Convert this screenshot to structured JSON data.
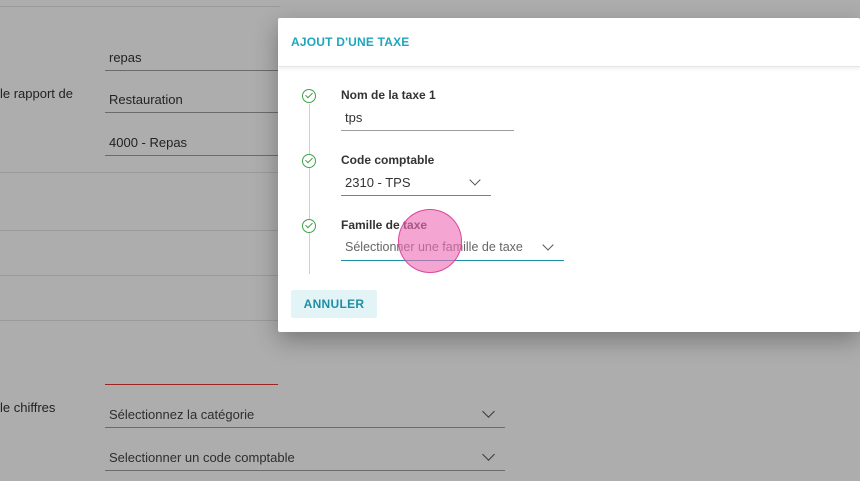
{
  "background_form": {
    "field_values": [
      "repas",
      "Restauration",
      "4000 - Repas"
    ],
    "partial_labels": [
      "le rapport de",
      "le chiffres"
    ],
    "category_placeholder": "Sélectionnez la catégorie",
    "account_placeholder": "Selectionner un code comptable"
  },
  "dialog": {
    "title": "AJOUT D'UNE TAXE",
    "steps": [
      {
        "label": "Nom de la taxe 1",
        "value": "tps"
      },
      {
        "label": "Code comptable",
        "value": "2310 - TPS"
      },
      {
        "label": "Famille de taxe",
        "placeholder": "Sélectionner une famille de taxe"
      }
    ],
    "cancel_label": "ANNULER"
  },
  "colors": {
    "accent": "#1ea6bd",
    "step_done": "#43a047",
    "error_underline": "#e53935"
  }
}
